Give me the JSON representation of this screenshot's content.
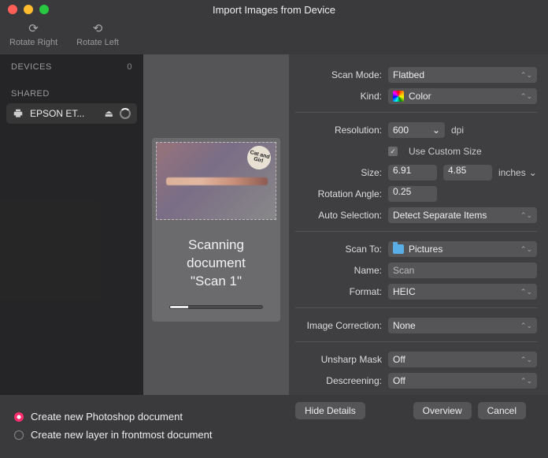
{
  "window": {
    "title": "Import Images from Device"
  },
  "toolbar": {
    "rotate_right": "Rotate Right",
    "rotate_left": "Rotate Left"
  },
  "sidebar": {
    "devices_label": "DEVICES",
    "devices_count": "0",
    "shared_label": "SHARED",
    "device_name": "EPSON ET..."
  },
  "preview": {
    "badge": "Cat and Girl",
    "status_line1": "Scanning",
    "status_line2": "document",
    "status_line3": "\"Scan 1\"",
    "progress_pct": "20"
  },
  "controls": {
    "scan_mode_label": "Scan Mode:",
    "scan_mode_value": "Flatbed",
    "kind_label": "Kind:",
    "kind_value": "Color",
    "resolution_label": "Resolution:",
    "resolution_value": "600",
    "resolution_unit": "dpi",
    "use_custom_size_label": "Use Custom Size",
    "size_label": "Size:",
    "size_w": "6.91",
    "size_h": "4.85",
    "size_unit": "inches",
    "rotation_label": "Rotation Angle:",
    "rotation_value": "0.25",
    "auto_sel_label": "Auto Selection:",
    "auto_sel_value": "Detect Separate Items",
    "scan_to_label": "Scan To:",
    "scan_to_value": "Pictures",
    "name_label": "Name:",
    "name_value": "Scan",
    "format_label": "Format:",
    "format_value": "HEIC",
    "image_corr_label": "Image Correction:",
    "image_corr_value": "None",
    "unsharp_label": "Unsharp Mask",
    "unsharp_value": "Off",
    "descreen_label": "Descreening:",
    "descreen_value": "Off"
  },
  "buttons": {
    "hide_details": "Hide Details",
    "overview": "Overview",
    "cancel": "Cancel"
  },
  "footer": {
    "opt1": "Create new Photoshop document",
    "opt2": "Create new layer in frontmost document"
  }
}
